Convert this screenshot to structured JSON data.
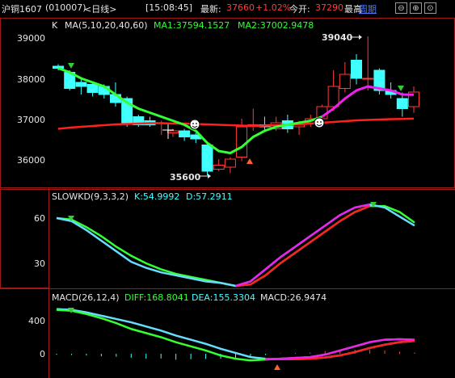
{
  "header": {
    "instrument": "沪铜1607",
    "code": "(010007)",
    "period": "<日线>",
    "time": "[15:08:45]",
    "latest_label": "最新:",
    "latest_value": "37660",
    "change_pct": "+1.02%",
    "open_label": "今开:",
    "open_value": "37290",
    "high_label": "最高",
    "cycle_label": "周期",
    "nav_buttons": [
      "⊖",
      "⊕",
      "⊙"
    ]
  },
  "colors": {
    "background": "#000000",
    "up": "#ff3c3c",
    "down": "#40ffff",
    "ma1": "#33ff33",
    "ma2": "#ff2020",
    "k_line": "#66ddff",
    "d_line": "#33ff33",
    "label_white": "#e6e6e6",
    "cyan_text": "#40ffff",
    "green_text": "#33ff33",
    "panel_border": "#a01818"
  },
  "main_panel": {
    "label": "K",
    "ma_label": "MA(5,10,20,40,60)",
    "ma1": "MA1:37594.1527",
    "ma2": "MA2:37002.9478",
    "y_ticks": [
      "39000",
      "38000",
      "37000",
      "36000"
    ],
    "annotation_high": "39040",
    "annotation_low": "35600"
  },
  "kd_panel": {
    "label": "SLOWKD(9,3,3,2)",
    "k_text": "K:54.9992",
    "d_text": "D:57.2911",
    "y_ticks": [
      "60",
      "30"
    ]
  },
  "macd_panel": {
    "label": "MACD(26,12,4)",
    "diff_text": "DIFF:168.8041",
    "dea_text": "DEA:155.3304",
    "macd_text": "MACD:26.9474",
    "y_ticks": [
      "400",
      "0"
    ]
  },
  "chart_data": {
    "type": "candlestick",
    "candles": [
      {
        "o": 38300,
        "h": 38350,
        "c": 38250,
        "l": 38200
      },
      {
        "o": 38150,
        "h": 38200,
        "c": 37750,
        "l": 37700
      },
      {
        "o": 37900,
        "h": 38000,
        "c": 37800,
        "l": 37600
      },
      {
        "o": 37850,
        "h": 37900,
        "c": 37650,
        "l": 37550
      },
      {
        "o": 37800,
        "h": 37850,
        "c": 37600,
        "l": 37500
      },
      {
        "o": 37600,
        "h": 37900,
        "c": 37400,
        "l": 37300
      },
      {
        "o": 37500,
        "h": 37550,
        "c": 36900,
        "l": 36800
      },
      {
        "o": 37050,
        "h": 37100,
        "c": 36850,
        "l": 36800
      },
      {
        "o": 36950,
        "h": 37050,
        "c": 36850,
        "l": 36800
      },
      {
        "o": 36900,
        "h": 36950,
        "c": 36900,
        "l": 36600
      },
      {
        "o": 36650,
        "h": 36750,
        "c": 36700,
        "l": 36550
      },
      {
        "o": 36700,
        "h": 36750,
        "c": 36550,
        "l": 36450
      },
      {
        "o": 36600,
        "h": 36650,
        "c": 36500,
        "l": 36400
      },
      {
        "o": 36350,
        "h": 36400,
        "c": 35700,
        "l": 35600
      },
      {
        "o": 35750,
        "h": 36000,
        "c": 35850,
        "l": 35700
      },
      {
        "o": 35800,
        "h": 36050,
        "c": 36000,
        "l": 35650
      },
      {
        "o": 36050,
        "h": 37000,
        "c": 36800,
        "l": 35950
      },
      {
        "o": 36850,
        "h": 37250,
        "c": 36850,
        "l": 36700
      },
      {
        "o": 36850,
        "h": 37050,
        "c": 36800,
        "l": 36700
      },
      {
        "o": 36750,
        "h": 37050,
        "c": 36900,
        "l": 36700
      },
      {
        "o": 36950,
        "h": 37100,
        "c": 36750,
        "l": 36650
      },
      {
        "o": 36800,
        "h": 36950,
        "c": 36900,
        "l": 36600
      },
      {
        "o": 36900,
        "h": 37100,
        "c": 37000,
        "l": 36800
      },
      {
        "o": 37000,
        "h": 37350,
        "c": 37300,
        "l": 36950
      },
      {
        "o": 37300,
        "h": 38200,
        "c": 37800,
        "l": 37200
      },
      {
        "o": 37750,
        "h": 38400,
        "c": 38100,
        "l": 37650
      },
      {
        "o": 38450,
        "h": 38600,
        "c": 38000,
        "l": 37850
      },
      {
        "o": 38000,
        "h": 39040,
        "c": 38000,
        "l": 37700
      },
      {
        "o": 38200,
        "h": 38250,
        "c": 37700,
        "l": 37600
      },
      {
        "o": 37700,
        "h": 37900,
        "c": 37600,
        "l": 37500
      },
      {
        "o": 37500,
        "h": 37650,
        "c": 37250,
        "l": 37050
      },
      {
        "o": 37300,
        "h": 37800,
        "c": 37660,
        "l": 37150
      }
    ],
    "ma1": [
      38250,
      38150,
      38000,
      37900,
      37800,
      37600,
      37400,
      37250,
      37150,
      37050,
      36950,
      36850,
      36700,
      36400,
      36200,
      36150,
      36300,
      36550,
      36700,
      36800,
      36850,
      36900,
      36950,
      37050,
      37250,
      37500,
      37700,
      37800,
      37750,
      37700,
      37600,
      37594
    ],
    "ma2": [
      36750,
      36780,
      36800,
      36820,
      36840,
      36860,
      36870,
      36880,
      36890,
      36890,
      36880,
      36880,
      36870,
      36860,
      36850,
      36840,
      36830,
      36820,
      36830,
      36840,
      36850,
      36860,
      36880,
      36900,
      36920,
      36940,
      36960,
      36970,
      36980,
      36990,
      36995,
      37003
    ],
    "kd_k": [
      60,
      58,
      52,
      45,
      38,
      31,
      27,
      24,
      22,
      20,
      18,
      17,
      15,
      18,
      26,
      34,
      41,
      48,
      55,
      62,
      67,
      69,
      67,
      61,
      55
    ],
    "kd_d": [
      60,
      59,
      54,
      48,
      41,
      35,
      30,
      26,
      23,
      21,
      19,
      17,
      15,
      16,
      22,
      30,
      37,
      44,
      51,
      58,
      64,
      68,
      68,
      64,
      57
    ],
    "kd_y_range": [
      10,
      75
    ],
    "macd_diff": [
      530,
      520,
      480,
      430,
      370,
      300,
      250,
      200,
      140,
      90,
      40,
      -20,
      -60,
      -80,
      -70,
      -60,
      -50,
      -40,
      -10,
      40,
      90,
      140,
      170,
      175,
      169
    ],
    "macd_dea": [
      540,
      530,
      500,
      460,
      420,
      380,
      330,
      280,
      220,
      170,
      120,
      60,
      10,
      -40,
      -60,
      -65,
      -65,
      -60,
      -45,
      -20,
      20,
      70,
      110,
      140,
      155
    ],
    "macd_hist": [
      -20,
      -25,
      -35,
      -50,
      -60,
      -80,
      -100,
      -95,
      -120,
      -110,
      -105,
      -100,
      -90,
      -60,
      -25,
      10,
      20,
      25,
      55,
      70,
      80,
      85,
      70,
      45,
      27
    ],
    "macd_y_range": [
      -280,
      650
    ]
  }
}
